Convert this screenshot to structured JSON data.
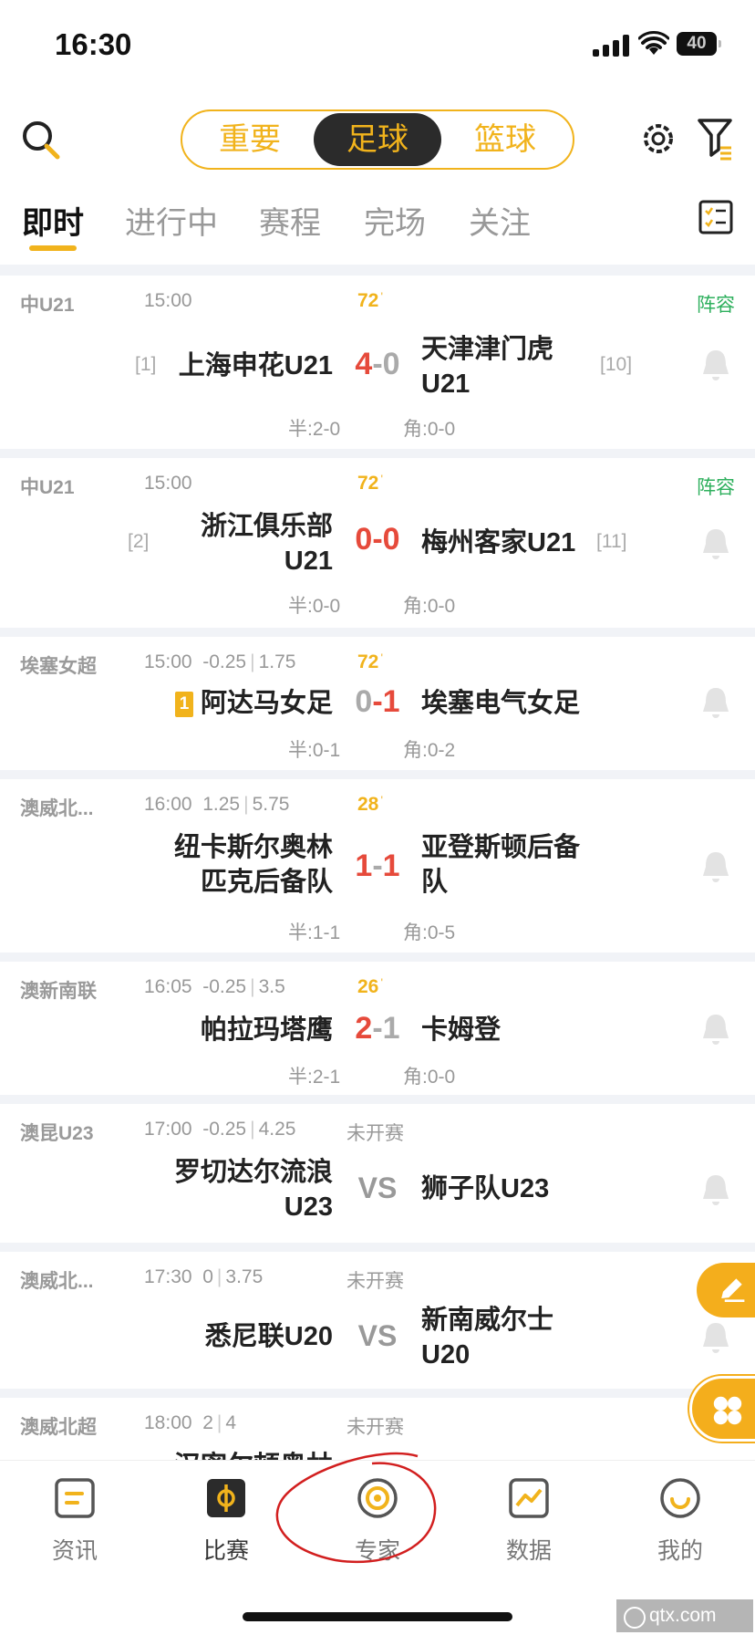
{
  "status_bar": {
    "time": "16:30",
    "battery": "40"
  },
  "header": {
    "segments": [
      "重要",
      "足球",
      "篮球"
    ],
    "active_segment": "足球"
  },
  "tabs": [
    "即时",
    "进行中",
    "赛程",
    "完场",
    "关注"
  ],
  "matches": [
    {
      "league": "中U21",
      "time": "15:00",
      "odds": "",
      "minute": "72",
      "state": "",
      "lineup": "阵容",
      "home": "上海申花U21",
      "home_rank": "[1]",
      "away": "天津津门虎U21",
      "away_rank": "[10]",
      "score_home": "4",
      "score_away": "0",
      "half": "半:2-0",
      "corner": "角:0-0"
    },
    {
      "league": "中U21",
      "time": "15:00",
      "odds": "",
      "minute": "72",
      "state": "",
      "lineup": "阵容",
      "home": "浙江俱乐部U21",
      "home_rank": "[2]",
      "away": "梅州客家U21",
      "away_rank": "[11]",
      "score_home": "0",
      "score_away": "0",
      "half": "半:0-0",
      "corner": "角:0-0"
    },
    {
      "league": "埃塞女超",
      "time": "15:00",
      "odds_a": "-0.25",
      "odds_b": "1.75",
      "minute": "72",
      "state": "",
      "lineup": "",
      "home_card": "1",
      "home": "阿达马女足",
      "away": "埃塞电气女足",
      "score_home": "0",
      "score_away": "1",
      "half": "半:0-1",
      "corner": "角:0-2"
    },
    {
      "league": "澳威北...",
      "time": "16:00",
      "odds_a": "1.25",
      "odds_b": "5.75",
      "minute": "28",
      "state": "",
      "lineup": "",
      "home": "纽卡斯尔奥林匹克后备队",
      "away": "亚登斯顿后备队",
      "score_home": "1",
      "score_away": "1",
      "half": "半:1-1",
      "corner": "角:0-5"
    },
    {
      "league": "澳新南联",
      "time": "16:05",
      "odds_a": "-0.25",
      "odds_b": "3.5",
      "minute": "26",
      "state": "",
      "lineup": "",
      "home": "帕拉玛塔鹰",
      "away": "卡姆登",
      "score_home": "2",
      "score_away": "1",
      "half": "半:2-1",
      "corner": "角:0-0"
    },
    {
      "league": "澳昆U23",
      "time": "17:00",
      "odds_a": "-0.25",
      "odds_b": "4.25",
      "minute": "",
      "state": "未开赛",
      "lineup": "",
      "home": "罗切达尔流浪U23",
      "away": "狮子队U23",
      "vs": "VS"
    },
    {
      "league": "澳威北...",
      "time": "17:30",
      "odds_a": "0",
      "odds_b": "3.75",
      "minute": "",
      "state": "未开赛",
      "lineup": "",
      "home": "悉尼联U20",
      "away": "新南威尔士U20",
      "vs": "VS"
    },
    {
      "league": "澳威北超",
      "time": "18:00",
      "odds_a": "2",
      "odds_b": "4",
      "minute": "",
      "state": "未开赛",
      "lineup": "",
      "home": "汉密尔顿奥林",
      "away": ""
    }
  ],
  "bottom_nav": [
    {
      "label": "资讯",
      "icon": "news-icon"
    },
    {
      "label": "比赛",
      "icon": "match-icon"
    },
    {
      "label": "专家",
      "icon": "expert-icon"
    },
    {
      "label": "数据",
      "icon": "data-icon"
    },
    {
      "label": "我的",
      "icon": "profile-icon"
    }
  ],
  "watermark": "qtx.com",
  "colors": {
    "accent": "#f1b31c",
    "score_red": "#e64a3b",
    "lineup_green": "#2fb05e"
  }
}
